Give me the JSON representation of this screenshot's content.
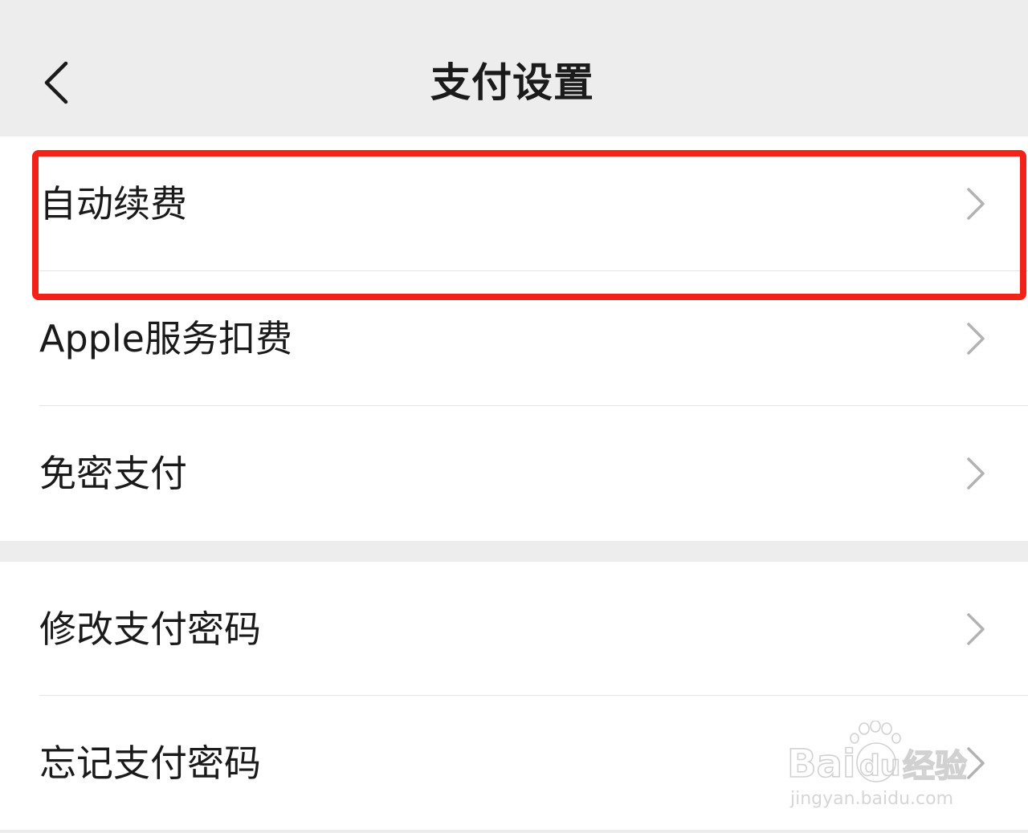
{
  "header": {
    "title": "支付设置",
    "back_icon": "chevron-left-icon"
  },
  "groups": [
    {
      "items": [
        {
          "label": "自动续费",
          "highlighted": true
        },
        {
          "label": "Apple服务扣费"
        },
        {
          "label": "免密支付"
        }
      ]
    },
    {
      "items": [
        {
          "label": "修改支付密码"
        },
        {
          "label": "忘记支付密码"
        }
      ]
    }
  ],
  "watermark": {
    "logo_text": "Bai du 经验",
    "url_text": "jingyan.baidu.com"
  },
  "colors": {
    "background": "#ededed",
    "cell_background": "#ffffff",
    "highlight": "#f2211a",
    "arrow": "#b2b2b2"
  }
}
